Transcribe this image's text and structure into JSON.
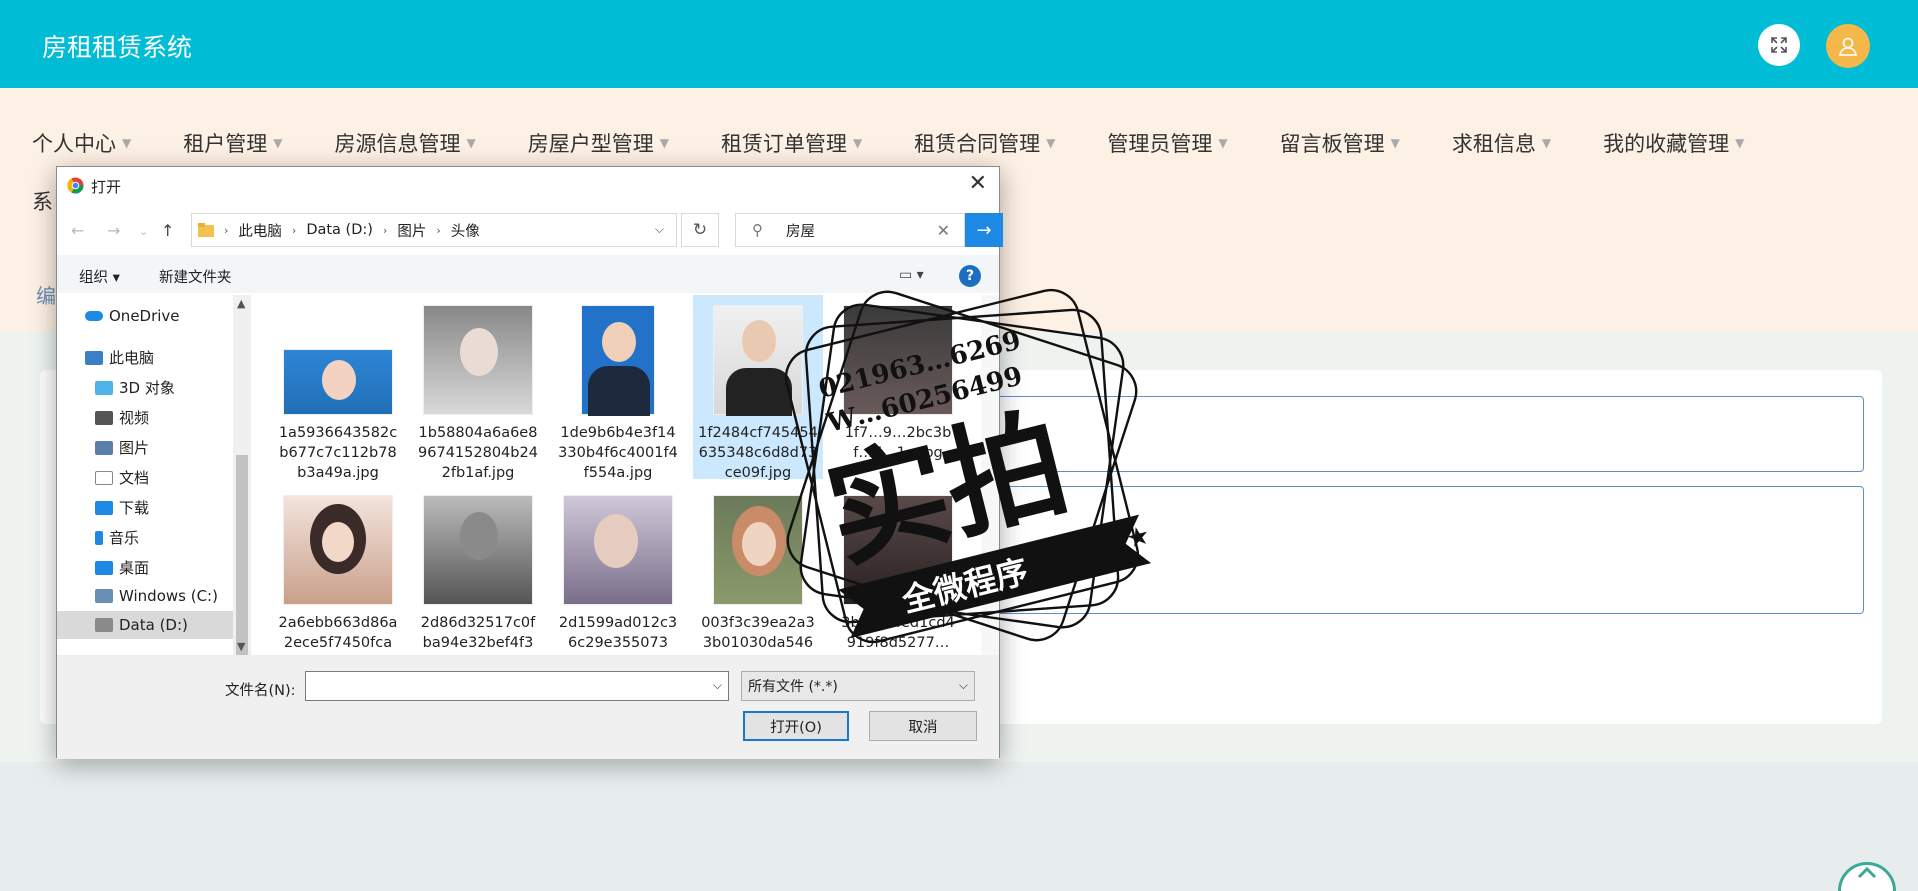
{
  "app": {
    "title": "房租租赁系统"
  },
  "nav": {
    "items": [
      {
        "label": "个人中心"
      },
      {
        "label": "租户管理"
      },
      {
        "label": "房源信息管理"
      },
      {
        "label": "房屋户型管理"
      },
      {
        "label": "租赁订单管理"
      },
      {
        "label": "租赁合同管理"
      },
      {
        "label": "管理员管理"
      },
      {
        "label": "留言板管理"
      },
      {
        "label": "求租信息"
      },
      {
        "label": "我的收藏管理"
      }
    ],
    "row2_label": "系",
    "breadcrumb": "编"
  },
  "dialog": {
    "title": "打开",
    "address": {
      "segments": [
        "此电脑",
        "Data (D:)",
        "图片",
        "头像"
      ]
    },
    "search_value": "房屋",
    "commands": {
      "organize": "组织",
      "new_folder": "新建文件夹"
    },
    "tree": [
      {
        "label": "OneDrive",
        "icon": "cloud-icon",
        "color": "#1e88e5"
      },
      {
        "label": "此电脑",
        "icon": "computer-icon",
        "color": "#3b7fc4"
      },
      {
        "label": "3D 对象",
        "icon": "cube-icon",
        "color": "#4fb3e8"
      },
      {
        "label": "视频",
        "icon": "video-icon",
        "color": "#555555"
      },
      {
        "label": "图片",
        "icon": "picture-icon",
        "color": "#5b7fa8"
      },
      {
        "label": "文档",
        "icon": "document-icon",
        "color": "#888888"
      },
      {
        "label": "下载",
        "icon": "download-icon",
        "color": "#1e88e5"
      },
      {
        "label": "音乐",
        "icon": "music-icon",
        "color": "#1e88e5"
      },
      {
        "label": "桌面",
        "icon": "desktop-icon",
        "color": "#1e88e5"
      },
      {
        "label": "Windows (C:)",
        "icon": "drive-icon",
        "color": "#6a8fb5"
      },
      {
        "label": "Data (D:)",
        "icon": "drive-icon",
        "color": "#8a8a8a"
      }
    ],
    "files": [
      {
        "name": "1a5936643582cb677c7c112b78b3a49a.jpg",
        "thumb_color": "#1f6fb5"
      },
      {
        "name": "1b58804a6a6e89674152804b242fb1af.jpg",
        "thumb_color": "#a8a8a8"
      },
      {
        "name": "1de9b6b4e3f14330b4f6c4001f4f554a.jpg",
        "thumb_color": "#2272c9"
      },
      {
        "name": "1f2484cf745454635348c6d8d73ce09f.jpg",
        "thumb_color": "#d8d8d8"
      },
      {
        "name": "1f7…9…2bc3bf…7…1…jpg",
        "thumb_color": "#4a4a4a"
      },
      {
        "name": "2a6ebb663d86a2ece5f7450fca",
        "thumb_color": "#c9a08a"
      },
      {
        "name": "2d86d32517c0fba94e32bef4f3",
        "thumb_color": "#6e6e6e"
      },
      {
        "name": "2d1599ad012c36c29e355073",
        "thumb_color": "#9a8faa"
      },
      {
        "name": "003f3c39ea2a33b01030da546",
        "thumb_color": "#c98b68"
      },
      {
        "name": "3b8a2efed1cd4919f8d5277…",
        "thumb_color": "#5a4a4a"
      }
    ],
    "filename_label": "文件名(N):",
    "filename_value": "",
    "filetype": "所有文件 (*.*)",
    "open_label": "打开(O)",
    "cancel_label": "取消"
  },
  "watermark": {
    "phone": "021963…6269",
    "wx": "W…60256499",
    "big_text": "实拍",
    "ribbon_text": "全微程序"
  },
  "colors": {
    "accent": "#00bcd4",
    "nav_bg": "#fdf0e4",
    "avatar": "#f4b84a"
  }
}
